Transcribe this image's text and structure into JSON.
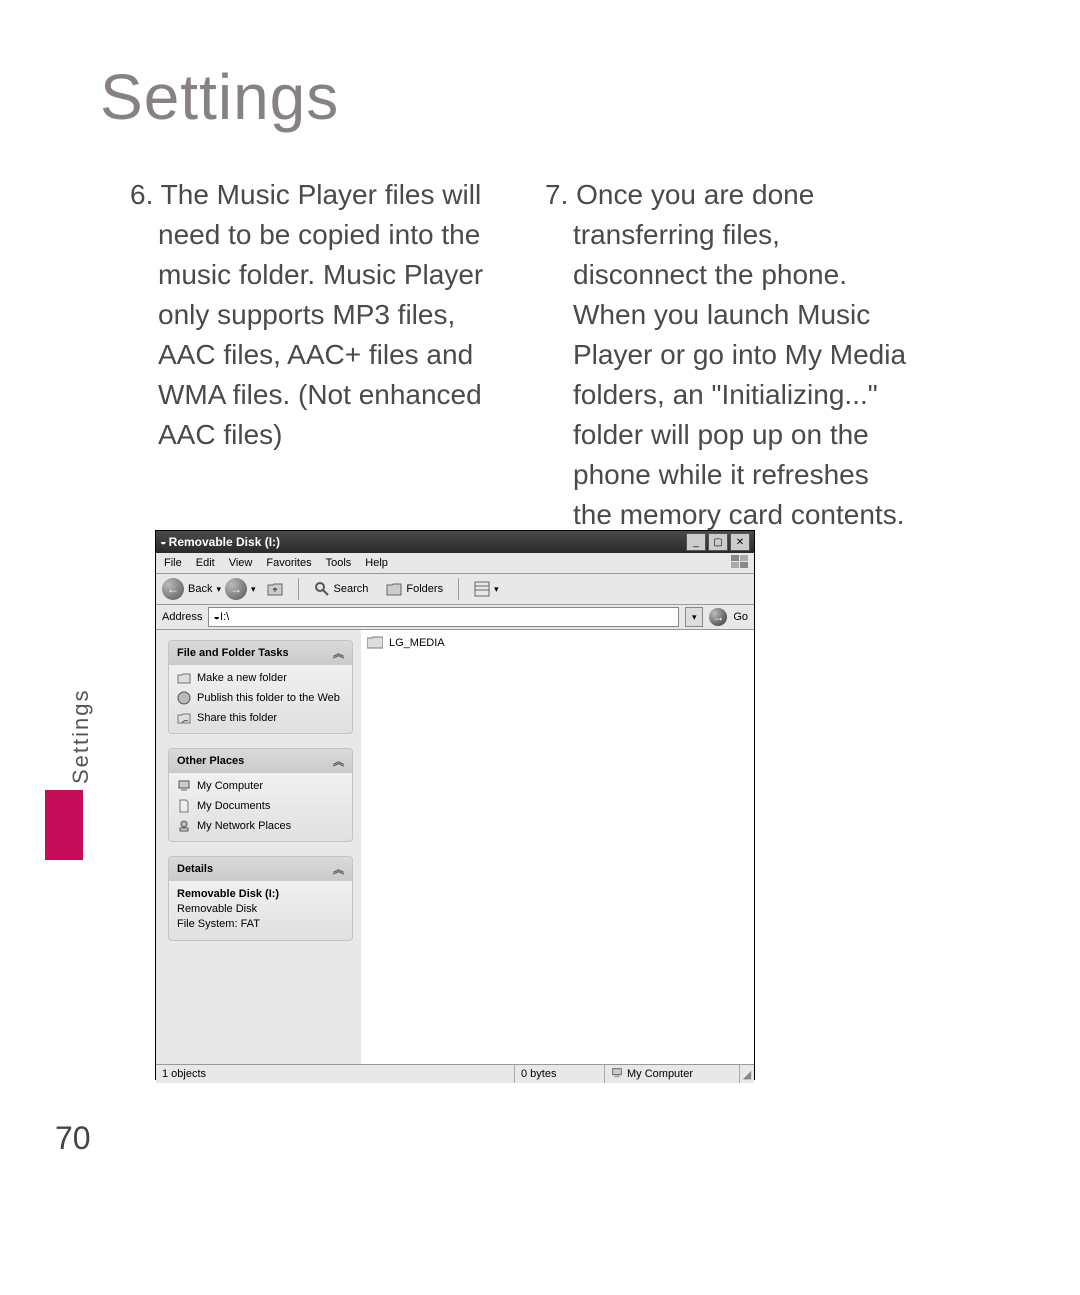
{
  "page": {
    "heading": "Settings",
    "side_label": "Settings",
    "number": "70",
    "para6_no": "6.",
    "para6": "The Music Player files will need to be copied into the music folder. Music Player only supports MP3 files, AAC files, AAC+ files and WMA files. (Not enhanced AAC files)",
    "para7_no": "7.",
    "para7": "Once you are done transferring files, disconnect the phone. When you launch Music Player or go into My Media folders, an \"Initializing...\" folder will pop up on the phone while it refreshes the memory card contents."
  },
  "explorer": {
    "title": "Removable Disk (I:)",
    "menus": {
      "file": "File",
      "edit": "Edit",
      "view": "View",
      "favorites": "Favorites",
      "tools": "Tools",
      "help": "Help"
    },
    "toolbar": {
      "back": "Back",
      "search": "Search",
      "folders": "Folders"
    },
    "address_label": "Address",
    "address_value": "I:\\",
    "go_label": "Go",
    "sidebar": {
      "tasks_title": "File and Folder Tasks",
      "tasks": {
        "new_folder": "Make a new folder",
        "publish": "Publish this folder to the Web",
        "share": "Share this folder"
      },
      "places_title": "Other Places",
      "places": {
        "my_computer": "My Computer",
        "my_documents": "My Documents",
        "network_places": "My Network Places"
      },
      "details_title": "Details",
      "details": {
        "name": "Removable Disk (I:)",
        "type": "Removable Disk",
        "fs": "File System: FAT"
      }
    },
    "files": {
      "item0": "LG_MEDIA"
    },
    "status": {
      "objects": "1 objects",
      "size": "0 bytes",
      "location": "My Computer"
    }
  }
}
